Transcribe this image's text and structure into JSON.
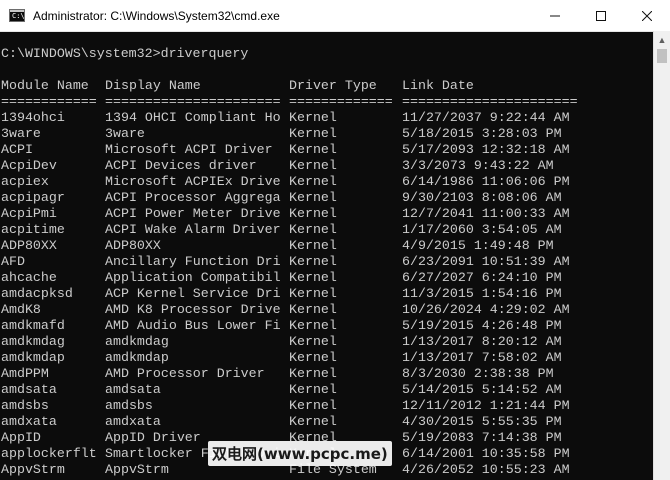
{
  "window": {
    "title": "Administrator: C:\\Windows\\System32\\cmd.exe",
    "icon": "cmd-icon",
    "controls": [
      "minimize-icon",
      "maximize-icon",
      "close-icon"
    ]
  },
  "console": {
    "prompt_line": "C:\\WINDOWS\\system32>driverquery",
    "headers": [
      "Module Name",
      "Display Name",
      "Driver Type",
      "Link Date"
    ],
    "separators": [
      "============",
      "======================",
      "=============",
      "======================"
    ],
    "rows": [
      [
        "1394ohci",
        "1394 OHCI Compliant Ho",
        "Kernel",
        "11/27/2037 9:22:44 AM"
      ],
      [
        "3ware",
        "3ware",
        "Kernel",
        "5/18/2015 3:28:03 PM"
      ],
      [
        "ACPI",
        "Microsoft ACPI Driver",
        "Kernel",
        "5/17/2093 12:32:18 AM"
      ],
      [
        "AcpiDev",
        "ACPI Devices driver",
        "Kernel",
        "3/3/2073 9:43:22 AM"
      ],
      [
        "acpiex",
        "Microsoft ACPIEx Drive",
        "Kernel",
        "6/14/1986 11:06:06 PM"
      ],
      [
        "acpipagr",
        "ACPI Processor Aggrega",
        "Kernel",
        "9/30/2103 8:08:06 AM"
      ],
      [
        "AcpiPmi",
        "ACPI Power Meter Drive",
        "Kernel",
        "12/7/2041 11:00:33 AM"
      ],
      [
        "acpitime",
        "ACPI Wake Alarm Driver",
        "Kernel",
        "1/17/2060 3:54:05 AM"
      ],
      [
        "ADP80XX",
        "ADP80XX",
        "Kernel",
        "4/9/2015 1:49:48 PM"
      ],
      [
        "AFD",
        "Ancillary Function Dri",
        "Kernel",
        "6/23/2091 10:51:39 AM"
      ],
      [
        "ahcache",
        "Application Compatibil",
        "Kernel",
        "6/27/2027 6:24:10 PM"
      ],
      [
        "amdacpksd",
        "ACP Kernel Service Dri",
        "Kernel",
        "11/3/2015 1:54:16 PM"
      ],
      [
        "AmdK8",
        "AMD K8 Processor Drive",
        "Kernel",
        "10/26/2024 4:29:02 AM"
      ],
      [
        "amdkmafd",
        "AMD Audio Bus Lower Fi",
        "Kernel",
        "5/19/2015 4:26:48 PM"
      ],
      [
        "amdkmdag",
        "amdkmdag",
        "Kernel",
        "1/13/2017 8:20:12 AM"
      ],
      [
        "amdkmdap",
        "amdkmdap",
        "Kernel",
        "1/13/2017 7:58:02 AM"
      ],
      [
        "AmdPPM",
        "AMD Processor Driver",
        "Kernel",
        "8/3/2030 2:38:38 PM"
      ],
      [
        "amdsata",
        "amdsata",
        "Kernel",
        "5/14/2015 5:14:52 AM"
      ],
      [
        "amdsbs",
        "amdsbs",
        "Kernel",
        "12/11/2012 1:21:44 PM"
      ],
      [
        "amdxata",
        "amdxata",
        "Kernel",
        "4/30/2015 5:55:35 PM"
      ],
      [
        "AppID",
        "AppID Driver",
        "Kernel",
        "5/19/2083 7:14:38 PM"
      ],
      [
        "applockerflt",
        "Smartlocker Filter Dri",
        "Kernel",
        "6/14/2001 10:35:58 PM"
      ],
      [
        "AppvStrm",
        "AppvStrm",
        "File System",
        "4/26/2052 10:55:23 AM"
      ]
    ]
  },
  "watermark": {
    "text": "双电网(www.pcpc.me)"
  }
}
